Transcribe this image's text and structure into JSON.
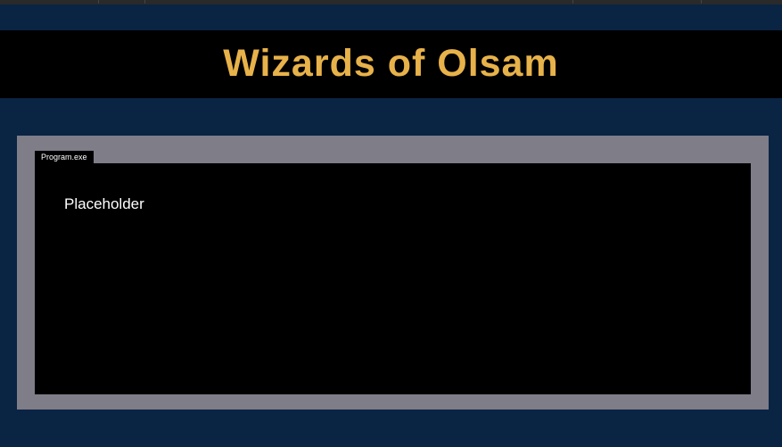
{
  "colors": {
    "page_background": "#0a2444",
    "header_background": "#000000",
    "title_color": "#e8b24a",
    "frame_color": "#7f7d88",
    "window_background": "#000000",
    "text_color": "#ffffff"
  },
  "header": {
    "title": "Wizards of Olsam"
  },
  "program": {
    "tab_label": "Program.exe",
    "content_text": "Placeholder"
  }
}
